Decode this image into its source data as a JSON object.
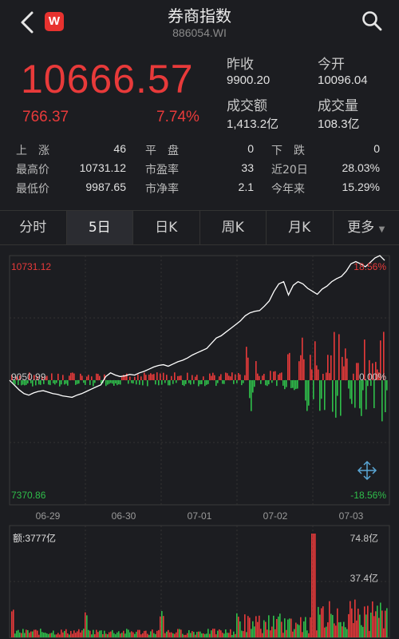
{
  "header": {
    "title": "券商指数",
    "code": "886054.WI",
    "logo_letter": "W"
  },
  "quote": {
    "price": "10666.57",
    "change": "766.37",
    "change_pct": "7.74%",
    "prev_close_label": "昨收",
    "prev_close": "9900.20",
    "open_label": "今开",
    "open": "10096.04",
    "turnover_label": "成交额",
    "turnover": "1,413.2亿",
    "volume_label": "成交量",
    "volume": "108.3亿",
    "rows": [
      {
        "a_label": "上　涨",
        "a_val": "46",
        "b_label": "平　盘",
        "b_val": "0",
        "c_label": "下　跌",
        "c_val": "0"
      },
      {
        "a_label": "最高价",
        "a_val": "10731.12",
        "b_label": "市盈率",
        "b_val": "33",
        "c_label": "近20日",
        "c_val": "28.03%"
      },
      {
        "a_label": "最低价",
        "a_val": "9987.65",
        "b_label": "市净率",
        "b_val": "2.1",
        "c_label": "今年来",
        "c_val": "15.29%"
      }
    ]
  },
  "tabs": [
    "分时",
    "5日",
    "日K",
    "周K",
    "月K",
    "更多"
  ],
  "active_tab": "5日",
  "colors": {
    "up": "#e83a3a",
    "down": "#2fbf4a",
    "line": "#ffffff"
  },
  "chart_data": {
    "type": "line",
    "y_max_label": "10731.12",
    "y_mid_label": "9050.99",
    "y_min_label": "7370.86",
    "pct_max_label": "18.56%",
    "pct_mid_label": "0.00%",
    "pct_min_label": "-18.56%",
    "x_labels": [
      "06-29",
      "06-30",
      "07-01",
      "07-02",
      "07-03"
    ],
    "ylim": [
      7370.86,
      10731.12
    ],
    "price_series": [
      9050,
      8985,
      8920,
      8870,
      8850,
      8880,
      8900,
      8910,
      8890,
      8870,
      8860,
      8840,
      8830,
      8820,
      8850,
      8870,
      8900,
      8930,
      8960,
      8990,
      9100,
      9150,
      9120,
      9100,
      9110,
      9130,
      9120,
      9150,
      9170,
      9200,
      9230,
      9250,
      9260,
      9240,
      9270,
      9300,
      9320,
      9350,
      9390,
      9420,
      9450,
      9480,
      9550,
      9620,
      9650,
      9700,
      9750,
      9800,
      9850,
      9920,
      9960,
      9980,
      9990,
      10050,
      10120,
      10250,
      10350,
      10380,
      10200,
      10330,
      10380,
      10350,
      10290,
      10250,
      10210,
      10280,
      10320,
      10380,
      10420,
      10450,
      10520,
      10620,
      10650,
      10620,
      10580,
      10640,
      10700,
      10731,
      10666
    ],
    "volume_label": "额:3777亿",
    "volume_max_label": "74.8亿",
    "volume_mid_label": "37.4亿"
  }
}
